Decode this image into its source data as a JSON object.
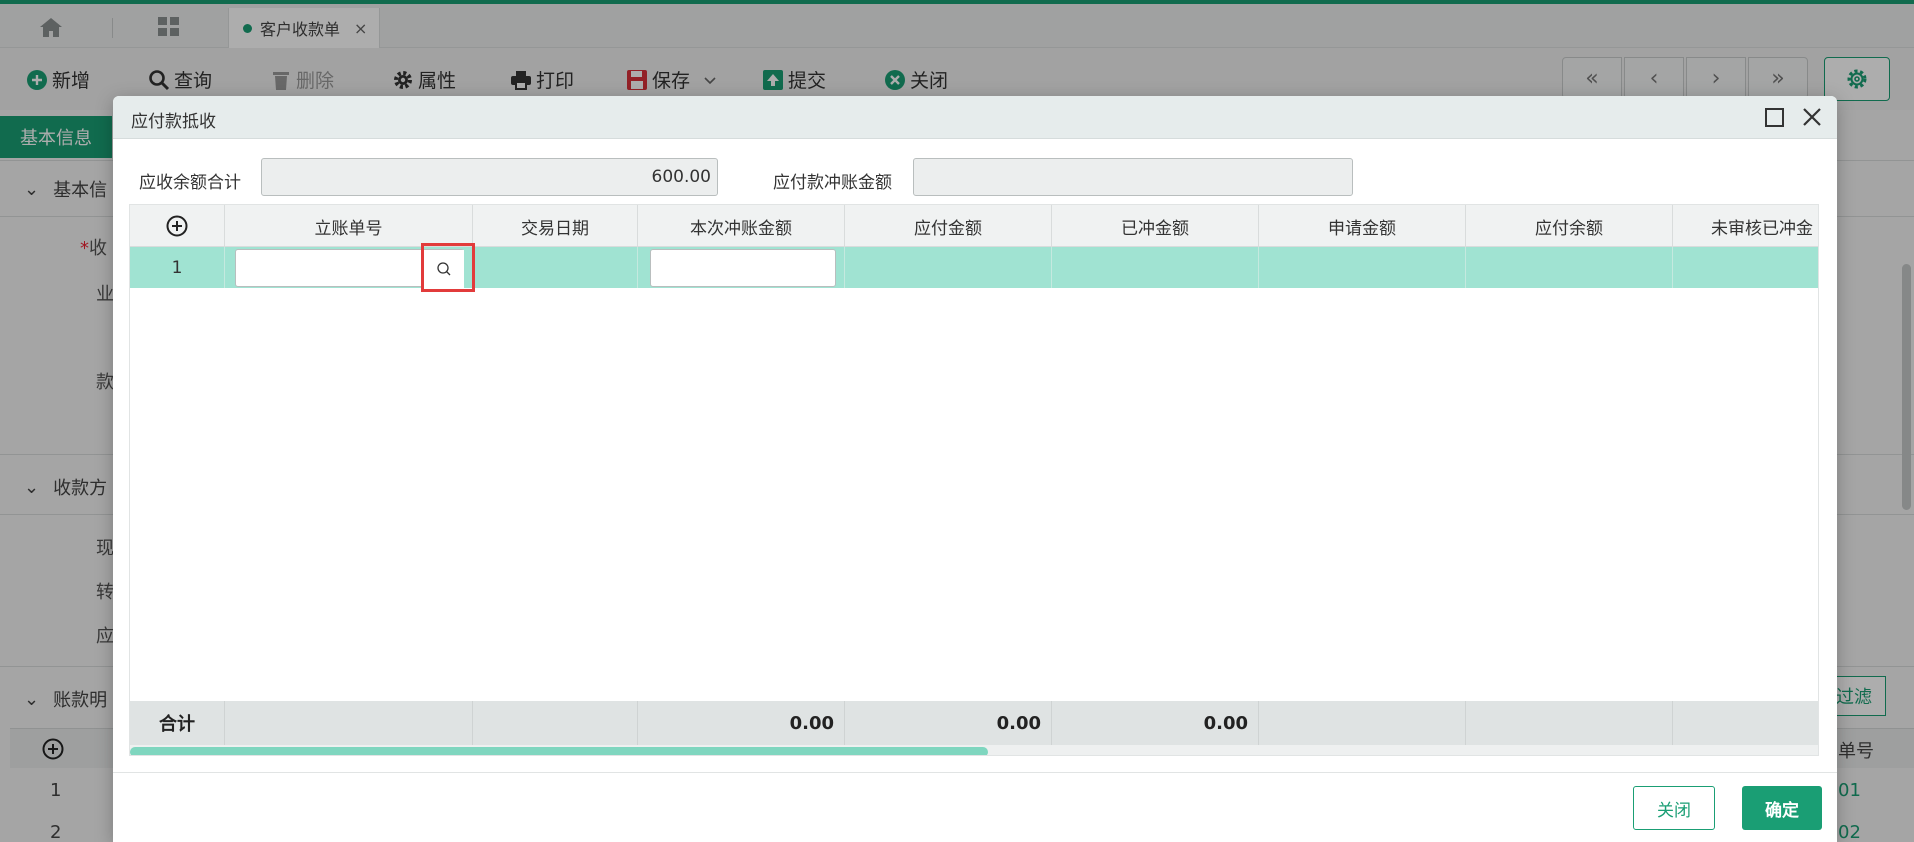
{
  "tabs": {
    "active_label": "客户收款单",
    "close_glyph": "×"
  },
  "toolbar": {
    "items": [
      {
        "label": "新增",
        "icon": "plus-circle-icon",
        "enabled": true
      },
      {
        "label": "查询",
        "icon": "search-icon",
        "enabled": true
      },
      {
        "label": "删除",
        "icon": "trash-icon",
        "enabled": false
      },
      {
        "label": "属性",
        "icon": "gear-icon",
        "enabled": true
      },
      {
        "label": "打印",
        "icon": "printer-icon",
        "enabled": true
      },
      {
        "label": "保存",
        "icon": "save-icon",
        "enabled": true
      },
      {
        "label": "提交",
        "icon": "upload-icon",
        "enabled": true
      },
      {
        "label": "关闭",
        "icon": "close-circle-icon",
        "enabled": true
      }
    ],
    "nav": {
      "first": "«",
      "prev": "‹",
      "next": "›",
      "last": "»"
    }
  },
  "background": {
    "tab_label": "基本信息",
    "sections": [
      "基本信",
      "收款方",
      "账款明"
    ],
    "labels": [
      "收",
      "业",
      "款",
      "现",
      "转",
      "应"
    ],
    "filter_label": "过滤",
    "grid_header_tail": "单号",
    "rows": [
      {
        "no": "1",
        "tail": "01"
      },
      {
        "no": "2",
        "tail": "02"
      }
    ]
  },
  "dialog": {
    "title": "应付款抵收",
    "receivable_total_label": "应收余额合计",
    "receivable_total_value": "600.00",
    "payable_offset_label": "应付款冲账金额",
    "payable_offset_value": "",
    "grid": {
      "columns": [
        "立账单号",
        "交易日期",
        "本次冲账金额",
        "应付金额",
        "已冲金额",
        "申请金额",
        "应付余额",
        "未审核已冲金"
      ],
      "rows": [
        {
          "no": "1",
          "account_no": "",
          "trade_date": "",
          "offset_amount": "",
          "payable": "",
          "offset_done": "",
          "applied": "",
          "balance": "",
          "unreviewed": ""
        }
      ],
      "footer": {
        "label": "合计",
        "offset_amount": "0.00",
        "payable": "0.00",
        "offset_done": "0.00"
      }
    },
    "buttons": {
      "close": "关闭",
      "ok": "确定"
    }
  },
  "colors": {
    "accent": "#1a9e74",
    "row_selected": "#a0e3d2",
    "highlight": "#e23b3b"
  }
}
